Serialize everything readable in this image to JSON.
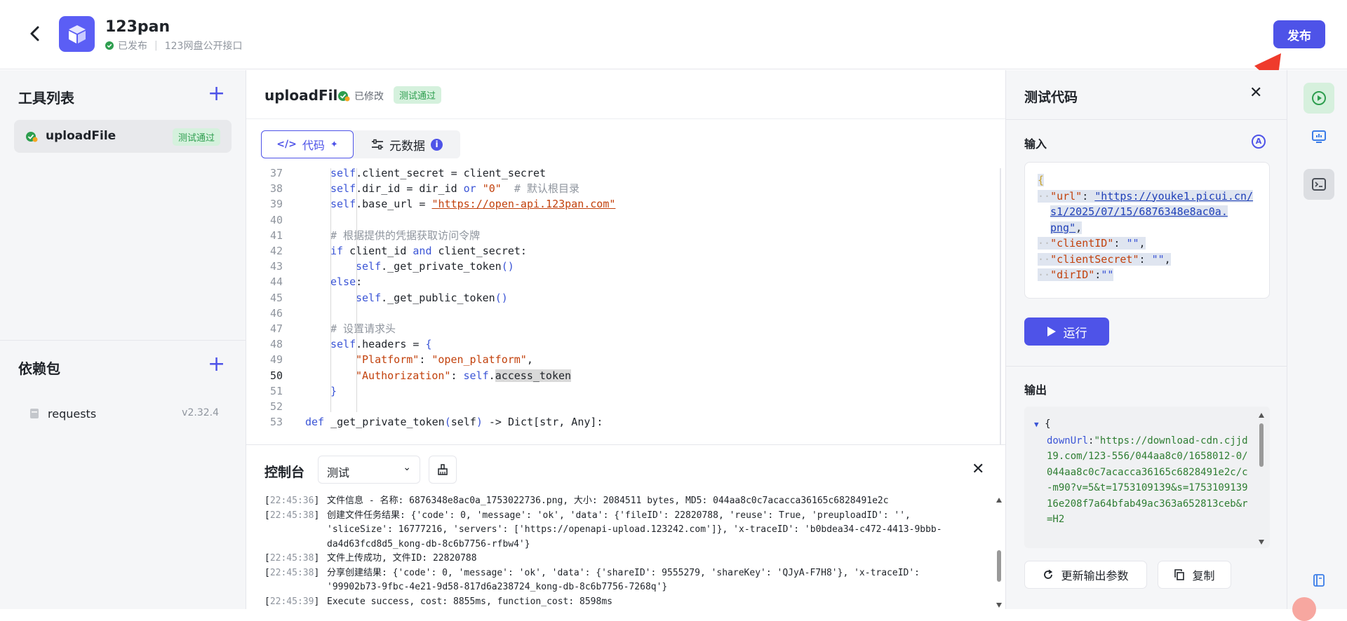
{
  "header": {
    "app_name": "123pan",
    "status": "已发布",
    "description": "123网盘公开接口",
    "publish_label": "发布",
    "accent": "#4e53e8"
  },
  "sidebar": {
    "tools_title": "工具列表",
    "tool_item": {
      "name": "uploadFile",
      "badge": "测试通过"
    },
    "deps_title": "依赖包",
    "dep_item": {
      "name": "requests",
      "version": "v2.32.4"
    }
  },
  "editor": {
    "title": "uploadFile",
    "modified": "已修改",
    "badge": "测试通过",
    "tab_code": "代码",
    "tab_meta": "元数据",
    "meta_info": "i",
    "lines": [
      {
        "n": "37",
        "indent": 2,
        "html": "<span class='k'>self</span>.client_secret = client_secret"
      },
      {
        "n": "38",
        "indent": 2,
        "html": "<span class='k'>self</span>.dir_id = dir_id <span class='k'>or</span> <span class='s'>\"0\"</span>  <span class='c'># 默认根目录</span>"
      },
      {
        "n": "39",
        "indent": 2,
        "html": "<span class='k'>self</span>.base_url = <span class='url'>\"https://open-api.123pan.com\"</span>"
      },
      {
        "n": "40",
        "indent": 0,
        "html": ""
      },
      {
        "n": "41",
        "indent": 2,
        "html": "<span class='c'># 根据提供的凭据获取访问令牌</span>"
      },
      {
        "n": "42",
        "indent": 2,
        "html": "<span class='k'>if</span> client_id <span class='k'>and</span> client_secret:"
      },
      {
        "n": "43",
        "indent": 3,
        "html": "<span class='k'>self</span>._get_private_token<span class='k'>()</span>"
      },
      {
        "n": "44",
        "indent": 2,
        "html": "<span class='k'>else</span>:"
      },
      {
        "n": "45",
        "indent": 3,
        "html": "<span class='k'>self</span>._get_public_token<span class='k'>()</span>"
      },
      {
        "n": "46",
        "indent": 0,
        "html": ""
      },
      {
        "n": "47",
        "indent": 2,
        "html": "<span class='c'># 设置请求头</span>"
      },
      {
        "n": "48",
        "indent": 2,
        "html": "<span class='k'>self</span>.headers = <span class='k'>{</span>"
      },
      {
        "n": "49",
        "indent": 3,
        "html": "<span class='s'>\"Platform\"</span>: <span class='s'>\"open_platform\"</span>,"
      },
      {
        "n": "50",
        "indent": 3,
        "html": "<span class='s'>\"Authorization\"</span>: <span class='k'>self</span>.<span style='background:#d9d9d9'>access_token</span>"
      },
      {
        "n": "51",
        "indent": 2,
        "html": "<span class='k'>}</span>"
      },
      {
        "n": "52",
        "indent": 0,
        "html": ""
      },
      {
        "n": "53",
        "indent": 1,
        "html": "<span class='k'>def</span> _get_private_token<span class='k'>(</span>self<span class='k'>)</span> -> Dict[str, Any]:"
      }
    ]
  },
  "console": {
    "title": "控制台",
    "select_value": "测试",
    "logs": [
      {
        "ts": "22:45:36",
        "msg": "文件信息 - 名称: 6876348e8ac0a_1753022736.png, 大小: 2084511 bytes, MD5: 044aa8c0c7acacca36165c6828491e2c"
      },
      {
        "ts": "22:45:38",
        "msg": "创建文件任务结果: {'code': 0, 'message': 'ok', 'data': {'fileID': 22820788, 'reuse': True, 'preuploadID': '',\n'sliceSize': 16777216, 'servers': ['https://openapi-upload.123242.com']}, 'x-traceID': 'b0bdea34-c472-4413-9bbb-\nda4d63fcd8d5_kong-db-8c6b7756-rfbw4'}"
      },
      {
        "ts": "22:45:38",
        "msg": "文件上传成功, 文件ID: 22820788"
      },
      {
        "ts": "22:45:38",
        "msg": "分享创建结果: {'code': 0, 'message': 'ok', 'data': {'shareID': 9555279, 'shareKey': 'QJyA-F7H8'}, 'x-traceID':\n'99902b73-9fbc-4e21-9d58-817d6a238724_kong-db-8c6b7756-7268q'}"
      },
      {
        "ts": "22:45:39",
        "msg": "Execute success, cost: 8855ms, function_cost: 8598ms"
      }
    ]
  },
  "test_panel": {
    "title": "测试代码",
    "input_label": "输入",
    "ai_label": "A",
    "input_json": {
      "open": "{",
      "url_key": "\"url\"",
      "url_val1": "\"https://youke1.picui.cn/",
      "url_val2": "s1/2025/07/15/6876348e8ac0a.",
      "url_val3": "png\"",
      "client_id_key": "\"clientID\"",
      "client_id_val": "\"\"",
      "client_secret_key": "\"clientSecret\"",
      "client_secret_val": "\"\"",
      "dir_key": "\"dirID\"",
      "dir_val": "\"\""
    },
    "run_label": "运行",
    "output_label": "输出",
    "output": {
      "brace": "{",
      "key": "downUrl",
      "value": "\"https://download-cdn.cjjd19.com/123-556/044aa8c0/1658012-0/044aa8c0c7acacca36165c6828491e2c/c-m90?v=5&t=1753109139&s=175310913916e208f7a64bfab49ac363a652813ceb&r=H2"
    },
    "update_label": "更新输出参数",
    "copy_label": "复制"
  }
}
